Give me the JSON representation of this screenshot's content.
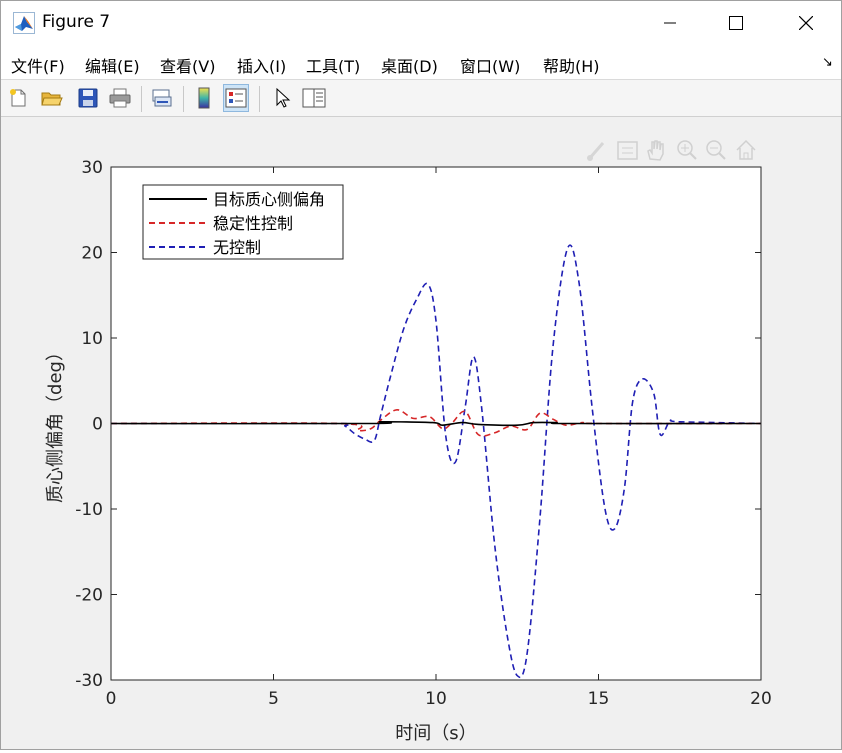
{
  "window": {
    "title": "Figure 7"
  },
  "menu": [
    {
      "label": "文件(F)"
    },
    {
      "label": "编辑(E)"
    },
    {
      "label": "查看(V)"
    },
    {
      "label": "插入(I)"
    },
    {
      "label": "工具(T)"
    },
    {
      "label": "桌面(D)"
    },
    {
      "label": "窗口(W)"
    },
    {
      "label": "帮助(H)"
    }
  ],
  "toolbar": [
    "new-figure",
    "open-file",
    "save",
    "print",
    "link-plot",
    "insert-colorbar",
    "insert-legend",
    "edit-plot",
    "property-inspector"
  ],
  "axes_toolbar": [
    "brush",
    "data-tips",
    "pan",
    "zoom-in",
    "zoom-out",
    "home"
  ],
  "colors": {
    "target": "#000000",
    "stability": "#d62728",
    "uncontrolled": "#1f1fb4"
  },
  "chart_data": {
    "type": "line",
    "xlabel": "时间（s）",
    "ylabel": "质心侧偏角（deg）",
    "xlim": [
      0,
      20
    ],
    "ylim": [
      -30,
      30
    ],
    "xticks": [
      0,
      5,
      10,
      15,
      20
    ],
    "xtick_labels": [
      "0",
      "5",
      "10",
      "15",
      "20"
    ],
    "yticks": [
      30,
      20,
      10,
      0,
      -10,
      -20,
      -30
    ],
    "ytick_labels": [
      "30",
      "20",
      "10",
      "0",
      "-10",
      "-20",
      "-30"
    ],
    "legend_position": "top-left",
    "series": [
      {
        "name": "目标质心侧偏角",
        "style": "solid",
        "color": "#000000",
        "x": [
          0,
          8.0,
          8.3,
          9.9,
          10.2,
          10.8,
          11.3,
          12.5,
          13.0,
          13.7,
          14.1,
          20
        ],
        "y": [
          0,
          0,
          0.2,
          0.1,
          -0.2,
          0.1,
          -0.1,
          -0.2,
          0.1,
          0.1,
          0,
          0
        ]
      },
      {
        "name": "稳定性控制",
        "style": "dashed",
        "color": "#d62728",
        "x": [
          0,
          7.0,
          7.6,
          8.0,
          8.3,
          8.8,
          9.3,
          9.8,
          10.2,
          10.5,
          10.9,
          11.3,
          11.8,
          12.3,
          12.8,
          13.2,
          13.6,
          14.0,
          14.5,
          15.0,
          20
        ],
        "y": [
          0,
          0,
          -0.8,
          -0.6,
          0.4,
          1.6,
          0.6,
          0.8,
          -0.6,
          0.1,
          1.4,
          -1.3,
          -1.1,
          -0.3,
          -0.7,
          1.2,
          0.5,
          -0.2,
          0.1,
          0,
          0
        ]
      },
      {
        "name": "无控制",
        "style": "dashed",
        "color": "#1f1fb4",
        "x": [
          0,
          6.9,
          7.2,
          7.5,
          7.8,
          8.1,
          8.3,
          8.6,
          9.0,
          9.4,
          9.75,
          10.0,
          10.3,
          10.6,
          10.9,
          11.15,
          11.4,
          11.8,
          12.2,
          12.5,
          12.8,
          13.2,
          13.6,
          14.05,
          14.4,
          14.8,
          15.2,
          15.5,
          15.8,
          16.05,
          16.35,
          16.7,
          16.9,
          17.2,
          17.5,
          20
        ],
        "y": [
          0,
          0,
          -0.3,
          -1.2,
          -1.8,
          -2.0,
          1.0,
          5.5,
          11.0,
          14.5,
          16.3,
          12.0,
          -1.5,
          -4.5,
          2.0,
          7.8,
          2.0,
          -14.0,
          -25.0,
          -29.5,
          -27.0,
          -11.0,
          9.0,
          20.5,
          16.5,
          2.0,
          -10.0,
          -12.3,
          -7.5,
          2.5,
          5.2,
          3.5,
          -1.3,
          0.3,
          0.2,
          0
        ]
      }
    ]
  }
}
